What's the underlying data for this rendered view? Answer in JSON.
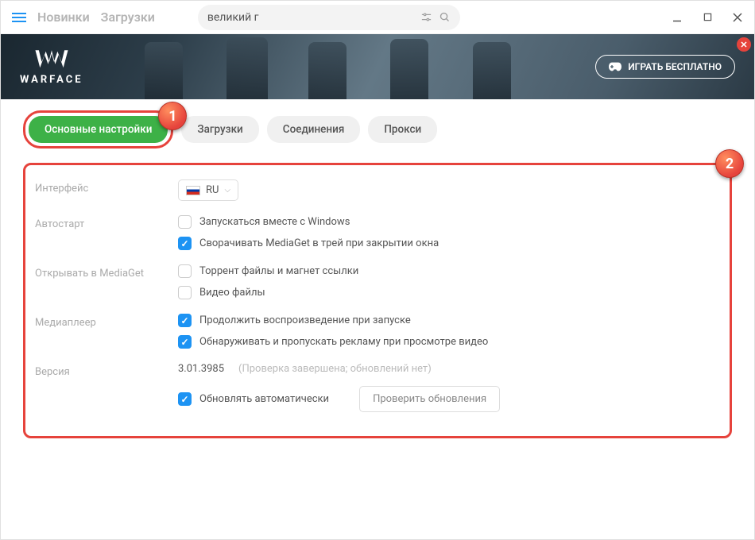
{
  "titlebar": {
    "nav": [
      "Новинки",
      "Загрузки"
    ],
    "search_value": "великий г"
  },
  "banner": {
    "brand": "WARFACE",
    "cta": "ИГРАТЬ БЕСПЛАТНО"
  },
  "tabs": {
    "active": "Основные настройки",
    "others": [
      "Загрузки",
      "Соединения",
      "Прокси"
    ]
  },
  "annotations": {
    "one": "1",
    "two": "2"
  },
  "settings": {
    "interface": {
      "label": "Интерфейс",
      "lang": "RU"
    },
    "autostart": {
      "label": "Автостарт",
      "opts": [
        {
          "text": "Запускаться вместе с Windows",
          "checked": false
        },
        {
          "text": "Сворачивать MediaGet в трей при закрытии окна",
          "checked": true
        }
      ]
    },
    "open_in": {
      "label": "Открывать в MediaGet",
      "opts": [
        {
          "text": "Торрент файлы и магнет ссылки",
          "checked": false
        },
        {
          "text": "Видео файлы",
          "checked": false
        }
      ]
    },
    "player": {
      "label": "Медиаплеер",
      "opts": [
        {
          "text": "Продолжить воспроизведение при запуске",
          "checked": true
        },
        {
          "text": "Обнаруживать и пропускать рекламу при просмотре видео",
          "checked": true
        }
      ]
    },
    "version": {
      "label": "Версия",
      "number": "3.01.3985",
      "status": "(Проверка завершена; обновлений нет)",
      "auto": {
        "text": "Обновлять автоматически",
        "checked": true
      },
      "check_btn": "Проверить обновления"
    }
  }
}
